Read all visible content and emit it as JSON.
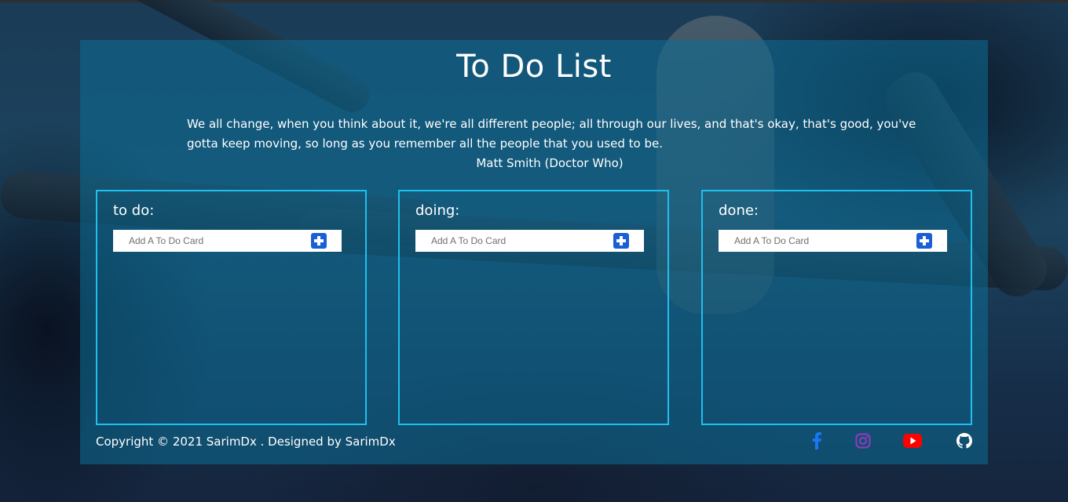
{
  "page": {
    "title": "To Do List",
    "quote": "We all change, when you think about it, we're all different people; all through our lives, and that's okay, that's good, you've gotta keep moving, so long as you remember all the people that you used to be.",
    "author": "Matt Smith (Doctor Who)"
  },
  "columns": [
    {
      "title": "to do:",
      "input_placeholder": "Add A To Do Card"
    },
    {
      "title": "doing:",
      "input_placeholder": "Add A To Do Card"
    },
    {
      "title": "done:",
      "input_placeholder": "Add A To Do Card"
    }
  ],
  "footer": {
    "copyright": "Copyright © 2021 SarimDx . Designed by SarimDx",
    "social": [
      {
        "icon": "facebook-icon",
        "color": "#1877f2"
      },
      {
        "icon": "instagram-icon",
        "color": "#8a3ab9"
      },
      {
        "icon": "youtube-icon",
        "color": "#ff0000"
      },
      {
        "icon": "github-icon",
        "color": "#ffffff"
      }
    ]
  },
  "colors": {
    "panel": "#0c6e96",
    "column_border": "#1ec0f0",
    "add_button": "#1a5fd6"
  }
}
